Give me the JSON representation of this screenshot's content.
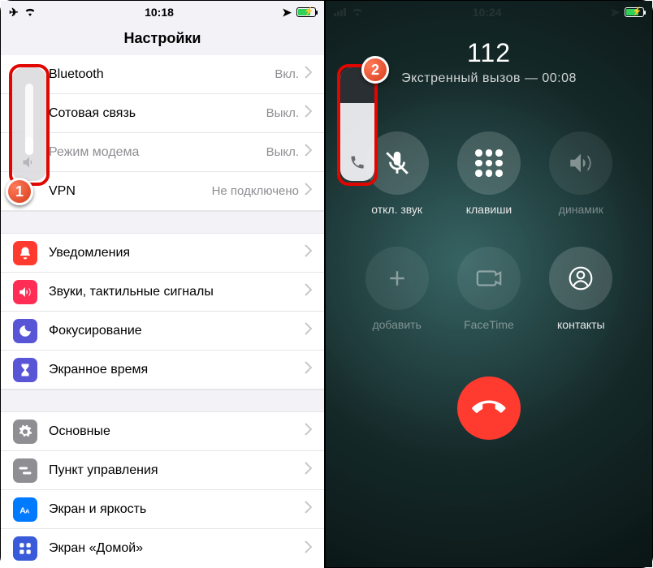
{
  "left": {
    "status": {
      "time": "10:18"
    },
    "title": "Настройки",
    "rows1": [
      {
        "label": "Bluetooth",
        "value": "Вкл."
      },
      {
        "label": "Сотовая связь",
        "value": "Выкл."
      },
      {
        "label": "Режим модема",
        "value": "Выкл."
      },
      {
        "label": "VPN",
        "value": "Не подключено"
      }
    ],
    "rows2": [
      {
        "label": "Уведомления"
      },
      {
        "label": "Звуки, тактильные сигналы"
      },
      {
        "label": "Фокусирование"
      },
      {
        "label": "Экранное время"
      }
    ],
    "rows3": [
      {
        "label": "Основные"
      },
      {
        "label": "Пункт управления"
      },
      {
        "label": "Экран и яркость"
      },
      {
        "label": "Экран «Домой»"
      }
    ],
    "badge": "1"
  },
  "right": {
    "status": {
      "time": "10:24"
    },
    "call": {
      "number": "112",
      "subtitle": "Экстренный вызов — 00:08"
    },
    "buttons": {
      "mute": "откл. звук",
      "keypad": "клавиши",
      "speaker": "динамик",
      "add": "добавить",
      "facetime": "FaceTime",
      "contacts": "контакты"
    },
    "badge": "2"
  }
}
